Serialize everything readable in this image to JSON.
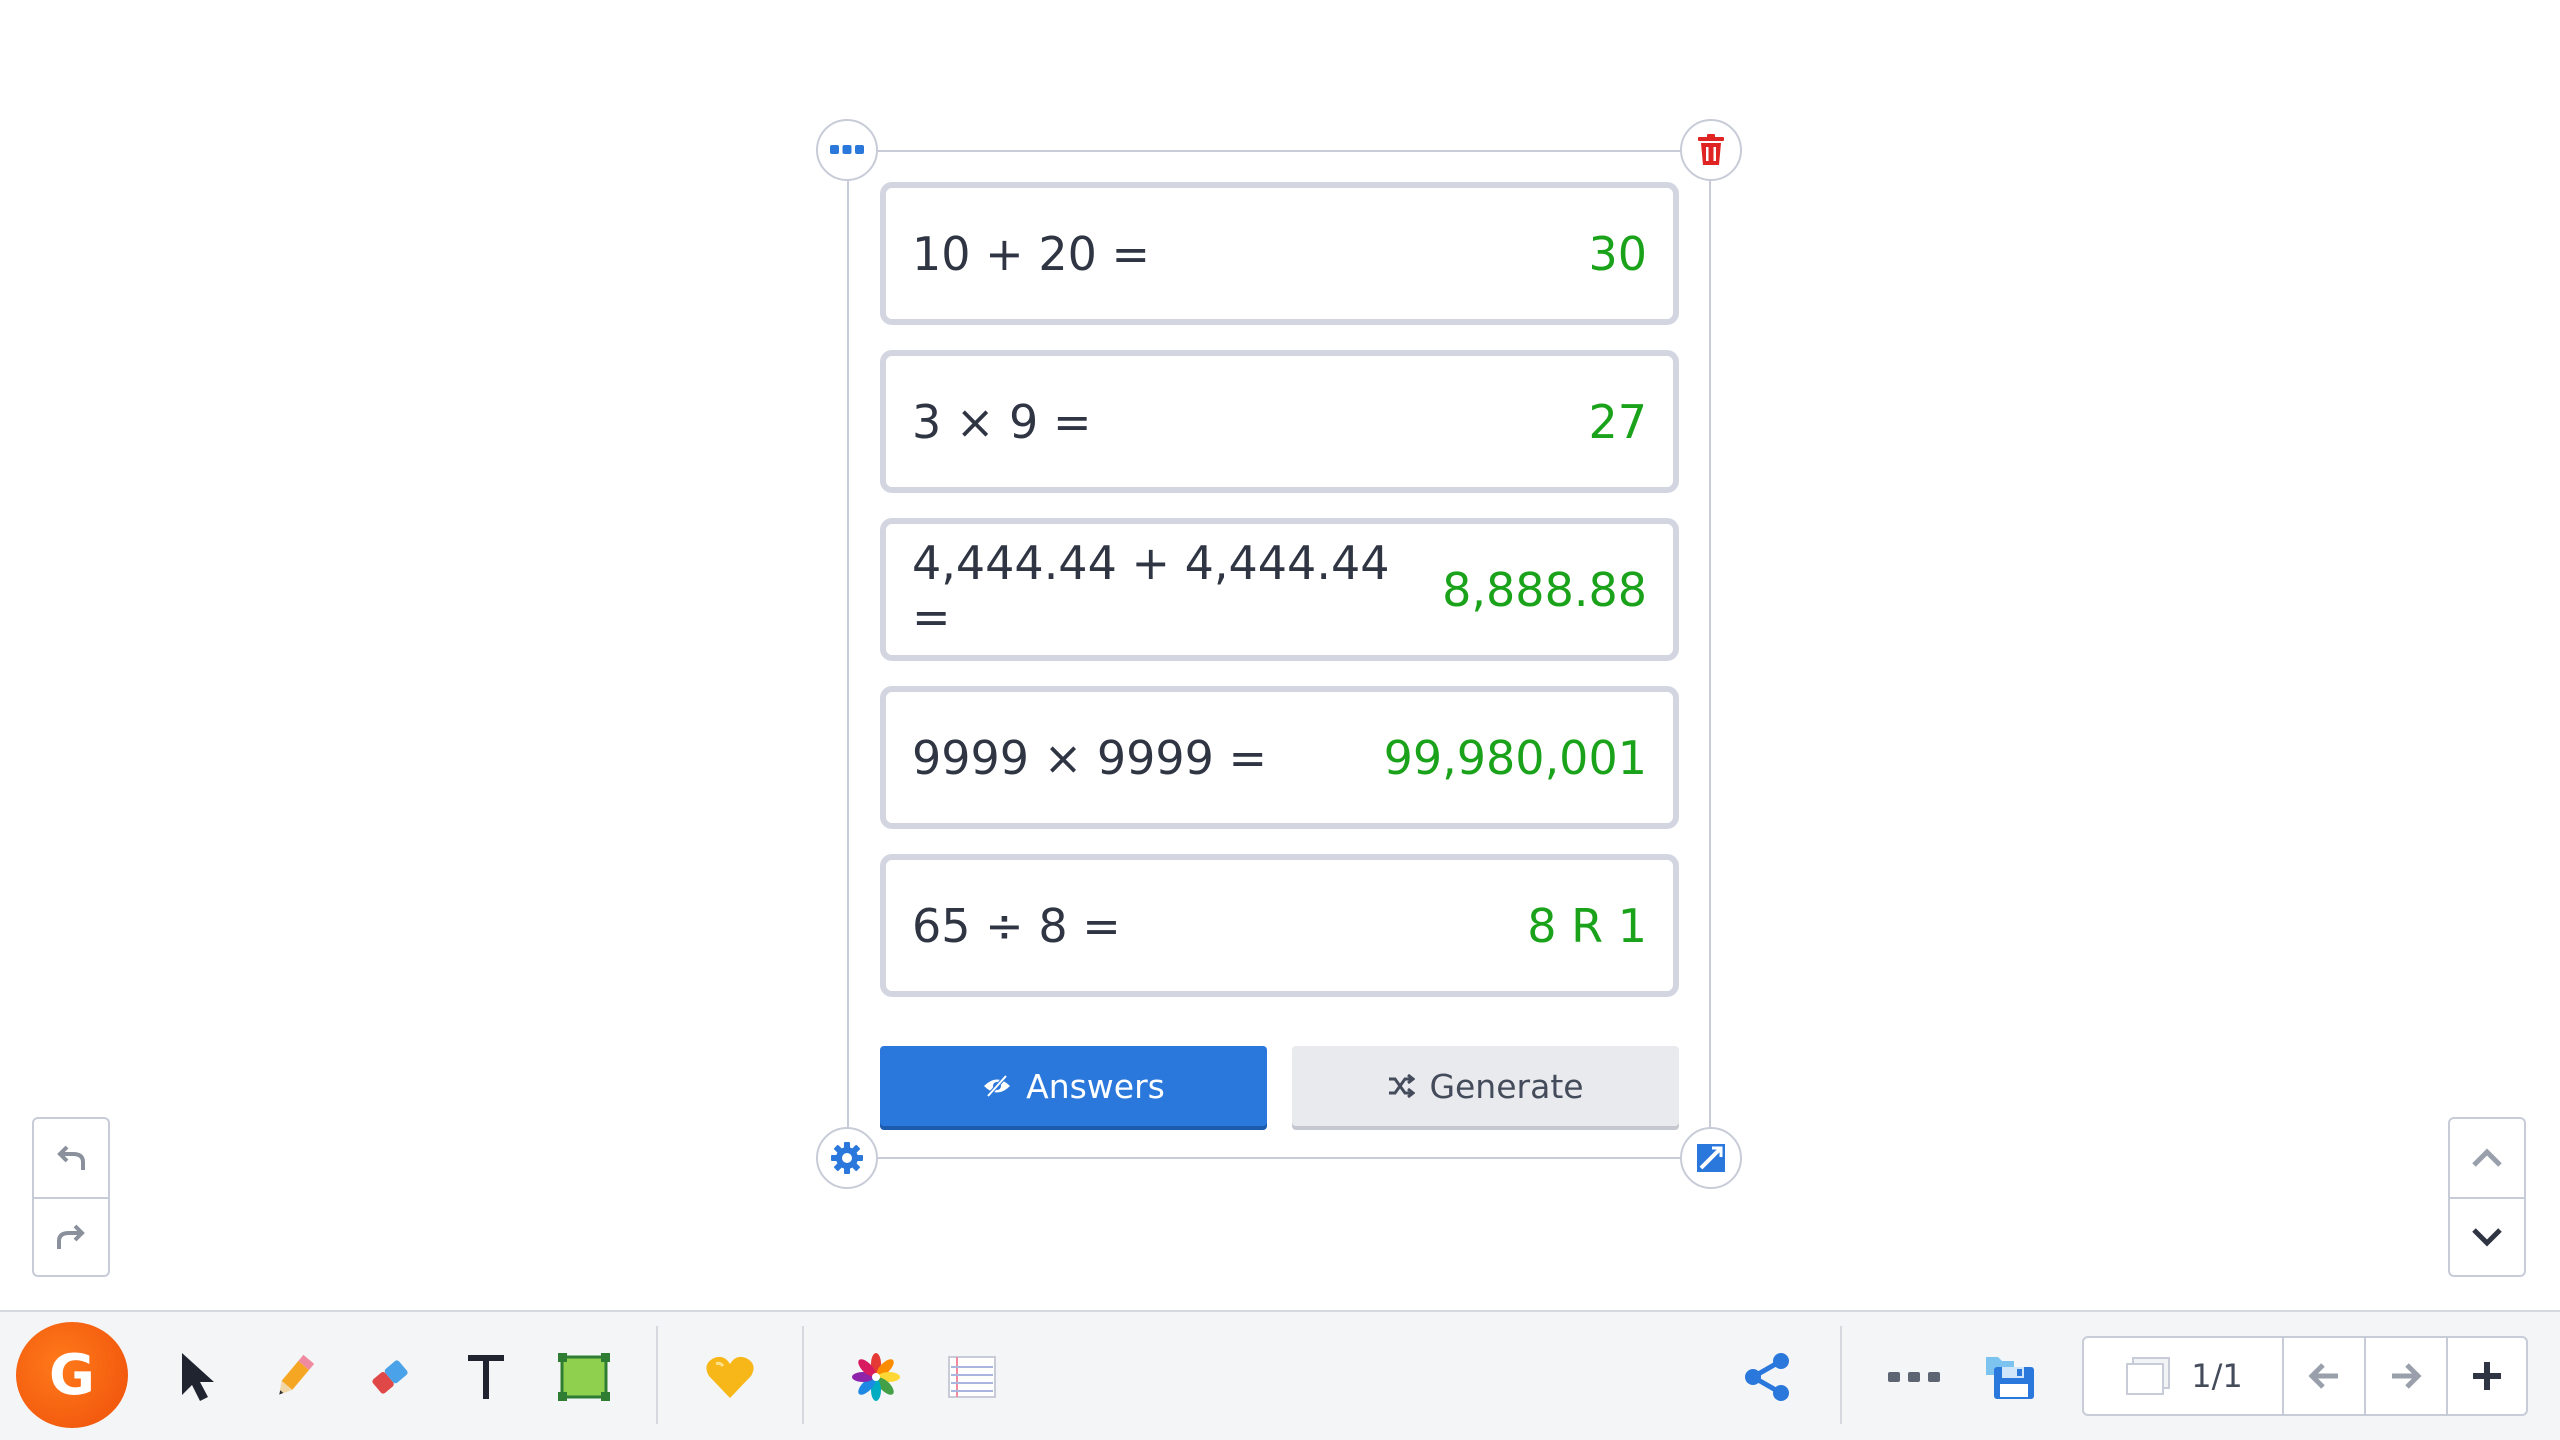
{
  "widget": {
    "problems": [
      {
        "question": "10 + 20 =",
        "answer": "30"
      },
      {
        "question": "3 × 9 =",
        "answer": "27"
      },
      {
        "question": "4,444.44 + 4,444.44 =",
        "answer": "8,888.88"
      },
      {
        "question": "9999 × 9999 =",
        "answer": "99,980,001"
      },
      {
        "question": "65 ÷ 8 =",
        "answer": "8 R 1"
      }
    ],
    "answers_button": "Answers",
    "generate_button": "Generate"
  },
  "toolbar": {
    "logo_letter": "G",
    "page_indicator": "1/1"
  },
  "colors": {
    "accent": "#2a78dc",
    "answer": "#1aa31a",
    "delete": "#e02424",
    "logo": "#f0600f"
  }
}
